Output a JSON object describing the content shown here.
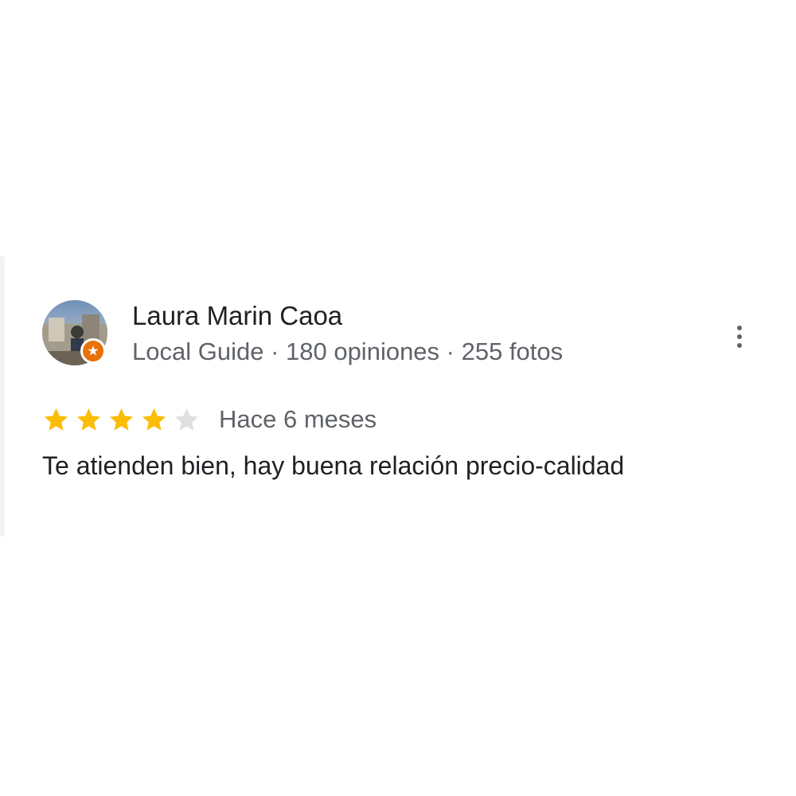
{
  "review": {
    "author": {
      "name": "Laura Marin Caoa",
      "badge_icon": "local-guide-badge-icon",
      "meta": "Local Guide · 180 opiniones · 255 fotos"
    },
    "rating": {
      "value": 4,
      "max": 5,
      "filled_color": "#fbbc04",
      "empty_color": "#e0e0e0"
    },
    "date": "Hace 6 meses",
    "text": "Te atienden bien, hay buena relación precio-calidad",
    "menu_icon": "more-vert-icon"
  },
  "colors": {
    "accent_badge": "#e8710a",
    "secondary_text": "#5f6368",
    "primary_text": "#202124"
  }
}
